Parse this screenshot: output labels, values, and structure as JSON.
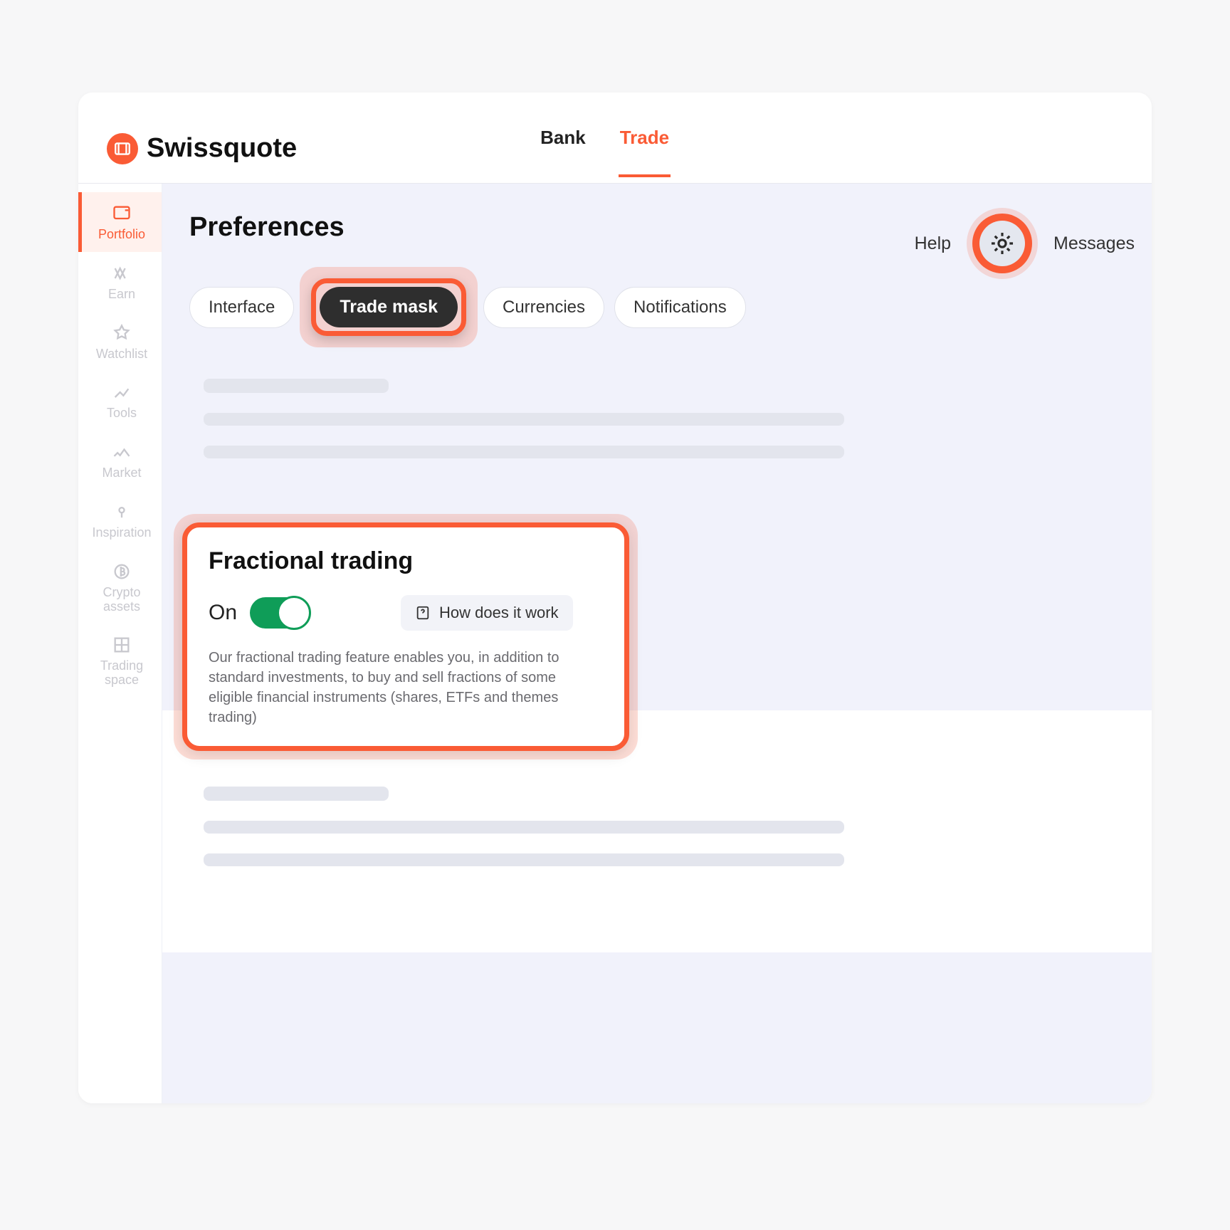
{
  "brand": "Swissquote",
  "top_tabs": {
    "bank": "Bank",
    "trade": "Trade"
  },
  "sidebar": {
    "items": [
      {
        "label": "Portfolio"
      },
      {
        "label": "Earn"
      },
      {
        "label": "Watchlist"
      },
      {
        "label": "Tools"
      },
      {
        "label": "Market"
      },
      {
        "label": "Inspiration"
      },
      {
        "label": "Crypto assets"
      },
      {
        "label": "Trading space"
      }
    ]
  },
  "page": {
    "title": "Preferences"
  },
  "top_right": {
    "help": "Help",
    "messages": "Messages"
  },
  "pref_tabs": {
    "interface": "Interface",
    "trade_mask": "Trade mask",
    "currencies": "Currencies",
    "notifications": "Notifications"
  },
  "fractional": {
    "title": "Fractional trading",
    "state": "On",
    "help_label": "How does it work",
    "description": "Our fractional trading feature enables you, in addition to standard investments, to buy and sell fractions of some eligible financial instruments (shares, ETFs and themes trading)"
  },
  "colors": {
    "accent": "#fa5b35",
    "toggle_on": "#0f9d58"
  }
}
